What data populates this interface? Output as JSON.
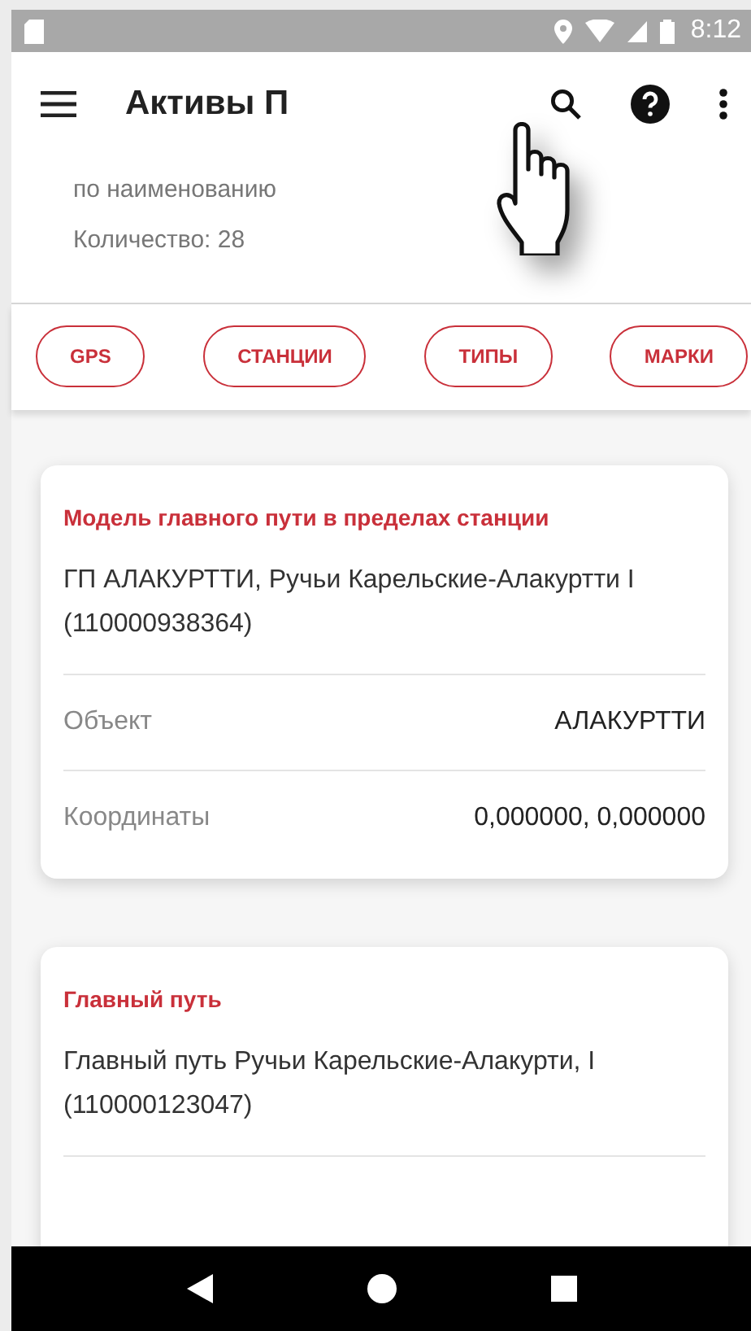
{
  "status_bar": {
    "time": "8:12"
  },
  "app_bar": {
    "title": "Активы П"
  },
  "summary": {
    "sort": "по наименованию",
    "count": "Количество: 28"
  },
  "filters": [
    "GPS",
    "СТАНЦИИ",
    "ТИПЫ",
    "МАРКИ"
  ],
  "cards": [
    {
      "type": "Модель главного пути в пределах станции",
      "name": "ГП АЛАКУРТТИ, Ручьи Карельские-Алакуртти I (110000938364)",
      "rows": [
        {
          "label": "Объект",
          "value": "АЛАКУРТТИ"
        },
        {
          "label": "Координаты",
          "value": "0,000000, 0,000000"
        }
      ]
    },
    {
      "type": "Главный путь",
      "name": "Главный путь Ручьи Карельские-Алакурти, I (110000123047)"
    }
  ]
}
